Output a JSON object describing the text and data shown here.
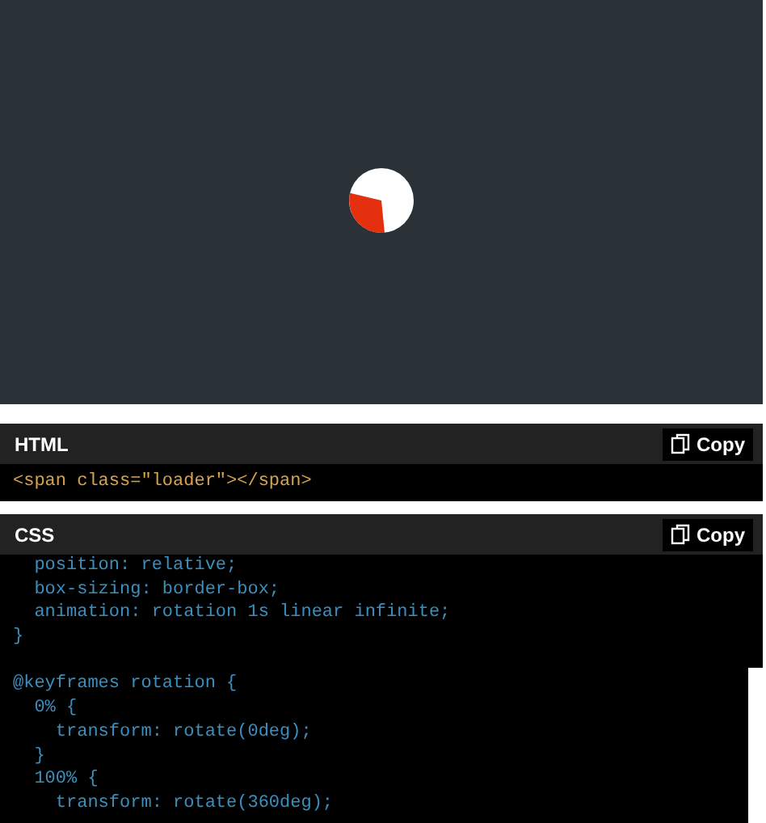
{
  "preview": {
    "kind": "loader"
  },
  "panels": [
    {
      "kind": "html",
      "title": "HTML",
      "copy_label": "Copy",
      "lines": [
        {
          "kind": "code",
          "text": "<span class=\"loader\"></span>"
        }
      ]
    },
    {
      "kind": "css",
      "title": "CSS",
      "copy_label": "Copy",
      "lines": [
        {
          "kind": "code",
          "text": "  position: relative;"
        },
        {
          "kind": "code",
          "text": "  box-sizing: border-box;"
        },
        {
          "kind": "code",
          "text": "  animation: rotation 1s linear infinite;"
        },
        {
          "kind": "code",
          "text": "}"
        },
        {
          "kind": "blank"
        },
        {
          "kind": "code",
          "text": "@keyframes rotation {"
        },
        {
          "kind": "code",
          "text": "  0% {"
        },
        {
          "kind": "code",
          "text": "    transform: rotate(0deg);"
        },
        {
          "kind": "code",
          "text": "  }"
        },
        {
          "kind": "code",
          "text": "  100% {"
        },
        {
          "kind": "code",
          "text": "    transform: rotate(360deg);"
        }
      ]
    }
  ]
}
